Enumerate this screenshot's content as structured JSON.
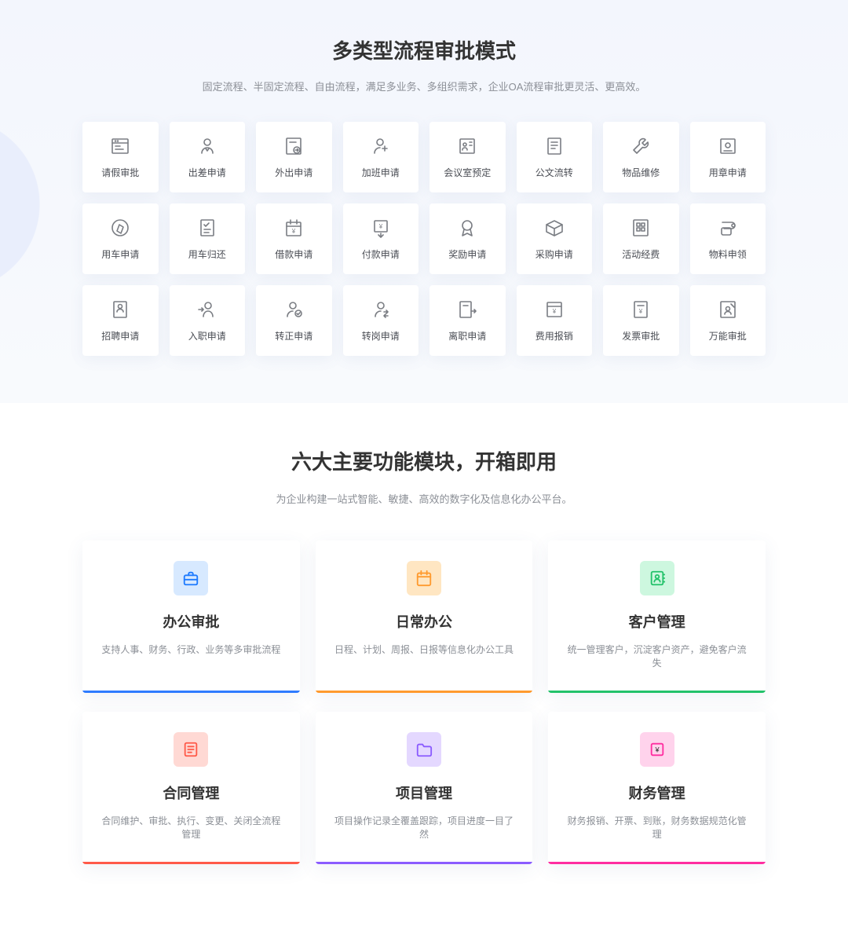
{
  "section1": {
    "title": "多类型流程审批模式",
    "subtitle": "固定流程、半固定流程、自由流程，满足多业务、多组织需求，企业OA流程审批更灵活、更高效。",
    "cards": [
      {
        "label": "请假审批",
        "icon": "form-icon"
      },
      {
        "label": "出差申请",
        "icon": "person-icon"
      },
      {
        "label": "外出申请",
        "icon": "exit-doc-icon"
      },
      {
        "label": "加班申请",
        "icon": "person-plus-icon"
      },
      {
        "label": "会议室预定",
        "icon": "meeting-room-icon"
      },
      {
        "label": "公文流转",
        "icon": "document-icon"
      },
      {
        "label": "物品维修",
        "icon": "wrench-icon"
      },
      {
        "label": "用章申请",
        "icon": "stamp-icon"
      },
      {
        "label": "用车申请",
        "icon": "compass-icon"
      },
      {
        "label": "用车归还",
        "icon": "list-check-icon"
      },
      {
        "label": "借款申请",
        "icon": "calendar-money-icon"
      },
      {
        "label": "付款申请",
        "icon": "money-down-icon"
      },
      {
        "label": "奖励申请",
        "icon": "medal-icon"
      },
      {
        "label": "采购申请",
        "icon": "box-icon"
      },
      {
        "label": "活动经费",
        "icon": "grid-doc-icon"
      },
      {
        "label": "物料申领",
        "icon": "roll-icon"
      },
      {
        "label": "招聘申请",
        "icon": "resume-icon"
      },
      {
        "label": "入职申请",
        "icon": "person-in-icon"
      },
      {
        "label": "转正申请",
        "icon": "person-check-icon"
      },
      {
        "label": "转岗申请",
        "icon": "person-swap-icon"
      },
      {
        "label": "离职申请",
        "icon": "exit-doc2-icon"
      },
      {
        "label": "费用报销",
        "icon": "expense-icon"
      },
      {
        "label": "发票审批",
        "icon": "invoice-icon"
      },
      {
        "label": "万能审批",
        "icon": "universal-icon"
      }
    ]
  },
  "section2": {
    "title": "六大主要功能模块，开箱即用",
    "subtitle": "为企业构建一站式智能、敏捷、高效的数字化及信息化办公平台。",
    "modules": [
      {
        "title": "办公审批",
        "desc": "支持人事、财务、行政、业务等多审批流程",
        "icon": "briefcase-icon",
        "accent": "blue"
      },
      {
        "title": "日常办公",
        "desc": "日程、计划、周报、日报等信息化办公工具",
        "icon": "calendar-icon",
        "accent": "orange"
      },
      {
        "title": "客户管理",
        "desc": "统一管理客户，沉淀客户资产，避免客户流失",
        "icon": "contacts-icon",
        "accent": "green"
      },
      {
        "title": "合同管理",
        "desc": "合同维护、审批、执行、变更、关闭全流程管理",
        "icon": "contract-icon",
        "accent": "red"
      },
      {
        "title": "项目管理",
        "desc": "项目操作记录全覆盖跟踪，项目进度一目了然",
        "icon": "folder-icon",
        "accent": "purple"
      },
      {
        "title": "财务管理",
        "desc": "财务报销、开票、到账，财务数据规范化管理",
        "icon": "finance-icon",
        "accent": "magenta"
      }
    ]
  }
}
